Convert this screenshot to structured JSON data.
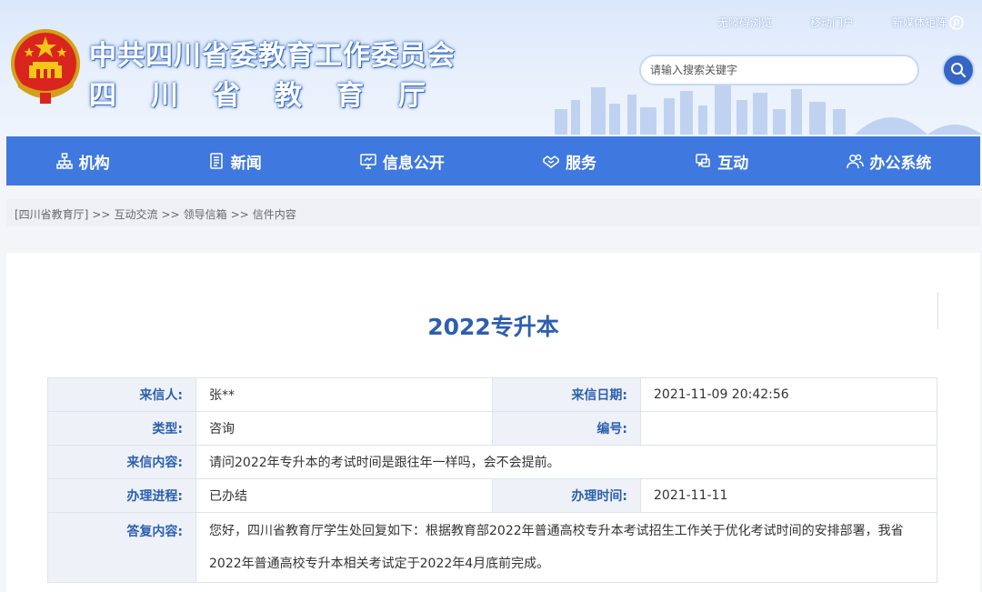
{
  "header": {
    "title": "中共四川省委教育工作委员会",
    "subtitle": "四川省教育厅",
    "toplinks": [
      "无障碍浏览",
      "移动门户",
      "新媒体矩阵"
    ],
    "search_placeholder": "请输入搜索关键字"
  },
  "nav": [
    {
      "label": "机构",
      "icon": "org-chart-icon"
    },
    {
      "label": "新闻",
      "icon": "news-icon"
    },
    {
      "label": "信息公开",
      "icon": "monitor-icon"
    },
    {
      "label": "服务",
      "icon": "handshake-icon"
    },
    {
      "label": "互动",
      "icon": "chat-icon"
    },
    {
      "label": "办公系统",
      "icon": "users-icon"
    }
  ],
  "breadcrumb": [
    "[四川省教育厅]",
    "互动交流",
    "领导信箱",
    "信件内容"
  ],
  "breadcrumb_sep": ">>",
  "letter": {
    "title": "2022专升本",
    "sender_label": "来信人:",
    "sender": "张**",
    "date_label": "来信日期:",
    "date": "2021-11-09 20:42:56",
    "type_label": "类型:",
    "type": "咨询",
    "number_label": "编号:",
    "number": "",
    "content_label": "来信内容:",
    "content": "请问2022年专升本的考试时间是跟往年一样吗，会不会提前。",
    "progress_label": "办理进程:",
    "progress": "已办结",
    "handle_time_label": "办理时间:",
    "handle_time": "2021-11-11",
    "reply_label": "答复内容:",
    "reply": "您好，四川省教育厅学生处回复如下：根据教育部2022年普通高校专升本考试招生工作关于优化考试时间的安排部署，我省2022年普通高校专升本相关考试定于2022年4月底前完成。"
  },
  "colors": {
    "nav_bg": "#3f78df",
    "accent": "#2c5fb0",
    "label_bg": "#eef2f8"
  }
}
